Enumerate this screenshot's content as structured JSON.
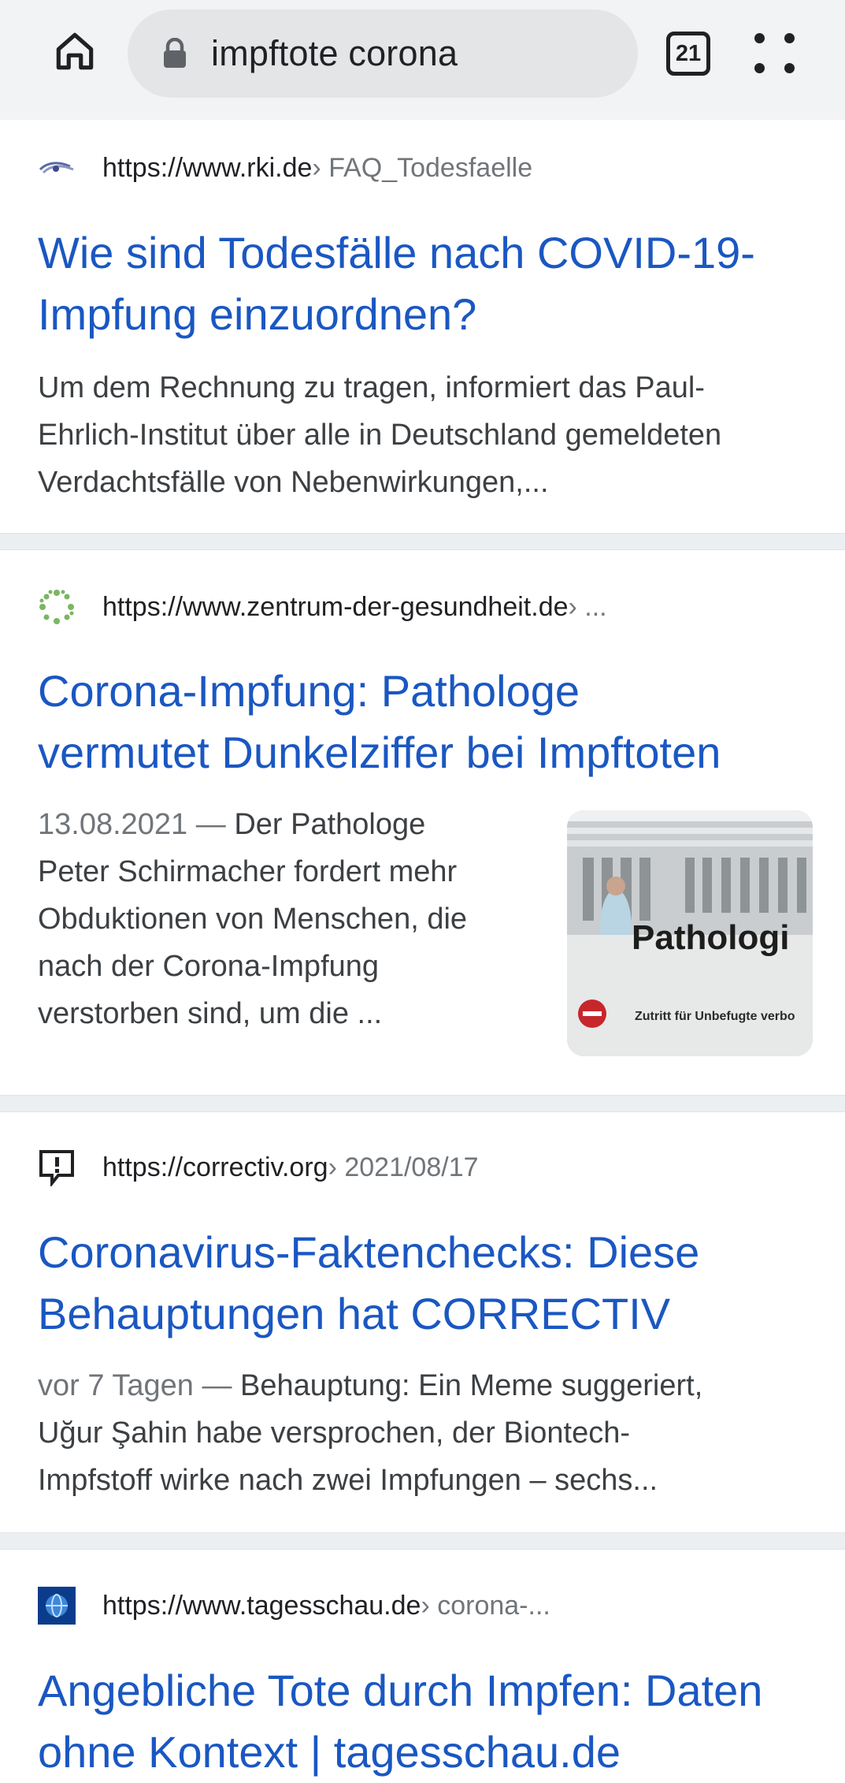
{
  "browser": {
    "search_query": "impftote corona",
    "tab_count": "21"
  },
  "results": [
    {
      "url": "https://www.rki.de",
      "path": " › FAQ_Todesfaelle",
      "title_line1": "Wie sind Todesfälle nach COVID-19-",
      "title_line2": "Impfung einzuordnen?",
      "snippet_line1": "Um dem Rechnung zu tragen, informiert das Paul-",
      "snippet_line2": "Ehrlich-Institut über alle in Deutschland gemeldeten",
      "snippet_line3": "Verdachtsfälle von Nebenwirkungen,..."
    },
    {
      "url": "https://www.zentrum-der-gesundheit.de",
      "path": " › ...",
      "title_line1": "Corona-Impfung: Pathologe",
      "title_line2": "vermutet Dunkelziffer bei Impftoten",
      "date": "13.08.2021",
      "dash": " — ",
      "snippet_line1": "Der Pathologe",
      "snippet_line2": "Peter Schirmacher fordert mehr",
      "snippet_line3": "Obduktionen von Menschen, die",
      "snippet_line4": "nach der Corona-Impfung",
      "snippet_line5": "verstorben sind, um die ...",
      "thumb_sign": "Pathologi",
      "thumb_subtext": "Zutritt für Unbefugte verbo"
    },
    {
      "url": "https://correctiv.org",
      "path": " › 2021/08/17",
      "title_line1": "Coronavirus-Faktenchecks: Diese",
      "title_line2": "Behauptungen hat CORRECTIV",
      "date": "vor 7 Tagen",
      "dash": " — ",
      "snippet_line1": "Behauptung: Ein Meme suggeriert,",
      "snippet_line2": "Uğur Şahin habe versprochen, der Biontech-",
      "snippet_line3": "Impfstoff wirke nach zwei Impfungen – sechs..."
    },
    {
      "url": "https://www.tagesschau.de",
      "path": " › corona-...",
      "title_line1": "Angebliche Tote durch Impfen: Daten",
      "title_line2": "ohne Kontext | tagesschau.de"
    }
  ],
  "colors": {
    "link": "#1a57c2",
    "toolbar_bg": "#f1f3f4",
    "separator": "#eceff1"
  }
}
